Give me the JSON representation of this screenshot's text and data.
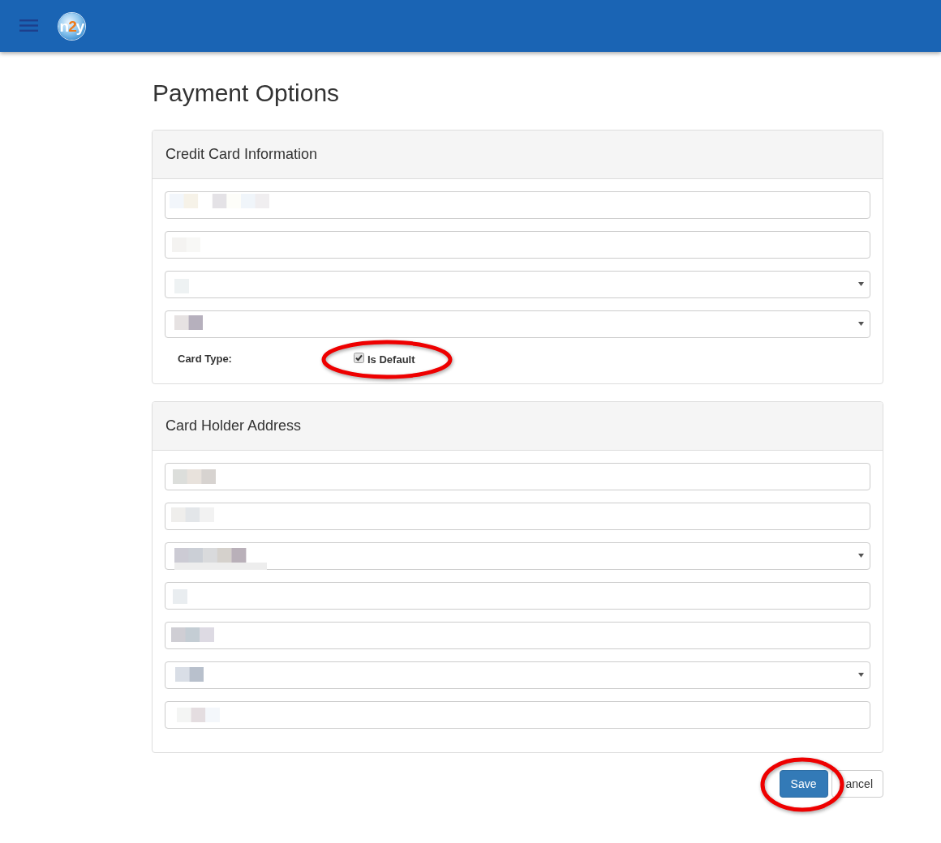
{
  "top_bar": {
    "logo": {
      "before": "n",
      "accent": "2",
      "after": "y"
    }
  },
  "page": {
    "title": "Payment Options"
  },
  "panels": [
    {
      "title": "Credit Card Information",
      "fields": [
        {
          "kind": "input",
          "redacted": true
        },
        {
          "kind": "input",
          "redacted": true
        },
        {
          "kind": "select",
          "redacted": true
        },
        {
          "kind": "select",
          "redacted": true
        }
      ],
      "card_type": {
        "label": "Card Type:",
        "default_option": {
          "label": "Is Default",
          "checked": true,
          "highlighted": true
        }
      }
    },
    {
      "title": "Card Holder Address",
      "fields": [
        {
          "kind": "input",
          "redacted": true
        },
        {
          "kind": "input",
          "redacted": true
        },
        {
          "kind": "select",
          "redacted": true
        },
        {
          "kind": "input",
          "redacted": true
        },
        {
          "kind": "input",
          "redacted": true
        },
        {
          "kind": "select",
          "redacted": true
        },
        {
          "kind": "input",
          "redacted": true
        }
      ]
    }
  ],
  "actions": [
    {
      "label": "Save",
      "kind": "primary",
      "highlighted": true
    },
    {
      "label": "ancel",
      "kind": "default",
      "highlighted": false
    }
  ]
}
